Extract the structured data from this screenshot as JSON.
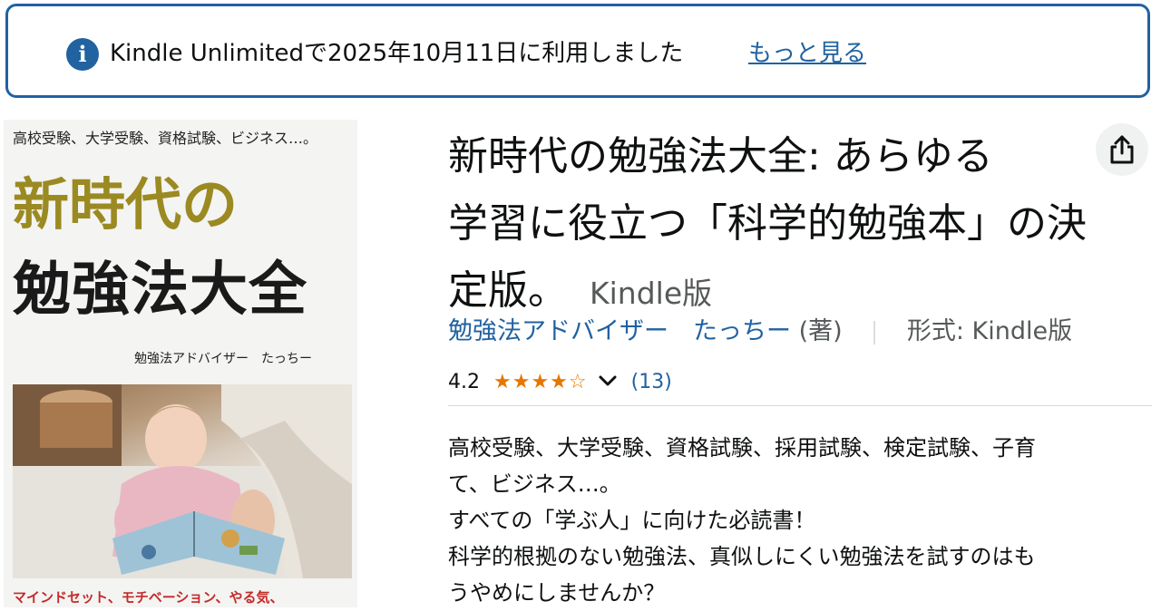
{
  "notice": {
    "icon": "info-icon",
    "text": "Kindle Unlimitedで2025年10月11日に利用しました",
    "link": "もっと見る",
    "color": "#2162a1"
  },
  "cover": {
    "tagline": "高校受験、大学受験、資格試験、ビジネス…。",
    "title_line1": "新時代の",
    "title_line2": "勉強法大全",
    "author": "勉強法アドバイザー　たっちー",
    "bottom_text": "マインドセット、モチベーション、やる気、"
  },
  "product": {
    "title_lines": [
      "新時代の勉強法大全: あらゆる",
      "学習に役立つ「科学的勉強本」の決",
      "定版。"
    ],
    "format_inline": "Kindle版",
    "author": "勉強法アドバイザー　たっちー",
    "role": "(著)",
    "format_label": "形式: Kindle版",
    "rating_value": "4.2",
    "stars": "★★★★☆",
    "rating_count": "(13)",
    "star_color": "#e77600",
    "link_color": "#2162a1"
  },
  "description": {
    "lines": [
      "高校受験、大学受験、資格試験、採用試験、検定試験、子育",
      "て、ビジネス…。",
      "すべての「学ぶ人」に向けた必読書！",
      "科学的根拠のない勉強法、真似しにくい勉強法を試すのはも",
      "うやめにしませんか？"
    ]
  },
  "icons": {
    "share": "share-icon",
    "dropdown": "chevron-down-icon"
  }
}
